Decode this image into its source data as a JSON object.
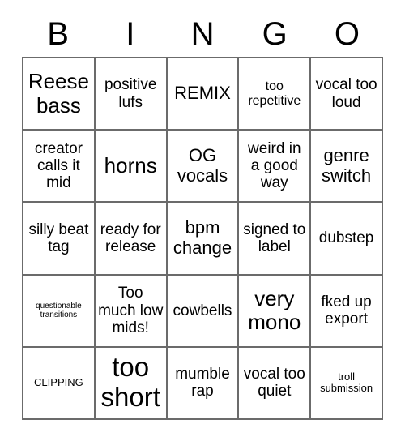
{
  "card": {
    "header_letters": [
      "B",
      "I",
      "N",
      "G",
      "O"
    ],
    "rows": [
      [
        {
          "text": "Reese bass",
          "size": "xl"
        },
        {
          "text": "positive lufs",
          "size": "m"
        },
        {
          "text": "REMIX",
          "size": "l"
        },
        {
          "text": "too repetitive",
          "size": "s"
        },
        {
          "text": "vocal too loud",
          "size": "m"
        }
      ],
      [
        {
          "text": "creator calls it mid",
          "size": "m"
        },
        {
          "text": "horns",
          "size": "xl"
        },
        {
          "text": "OG vocals",
          "size": "l"
        },
        {
          "text": "weird in a good way",
          "size": "m"
        },
        {
          "text": "genre switch",
          "size": "l"
        }
      ],
      [
        {
          "text": "silly beat tag",
          "size": "m"
        },
        {
          "text": "ready for release",
          "size": "m"
        },
        {
          "text": "bpm change",
          "size": "l"
        },
        {
          "text": "signed to label",
          "size": "m"
        },
        {
          "text": "dubstep",
          "size": "m"
        }
      ],
      [
        {
          "text": "questionable transitions",
          "size": "xxs"
        },
        {
          "text": "Too much low mids!",
          "size": "m"
        },
        {
          "text": "cowbells",
          "size": "m"
        },
        {
          "text": "very mono",
          "size": "xl"
        },
        {
          "text": "fked up export",
          "size": "m"
        }
      ],
      [
        {
          "text": "CLIPPING",
          "size": "xs"
        },
        {
          "text": "too short",
          "size": "xxl"
        },
        {
          "text": "mumble rap",
          "size": "m"
        },
        {
          "text": "vocal too quiet",
          "size": "m"
        },
        {
          "text": "troll submission",
          "size": "xs"
        }
      ]
    ]
  },
  "colors": {
    "background": "#ffffff",
    "grid_line": "#6b6b6b",
    "text": "#000000"
  }
}
